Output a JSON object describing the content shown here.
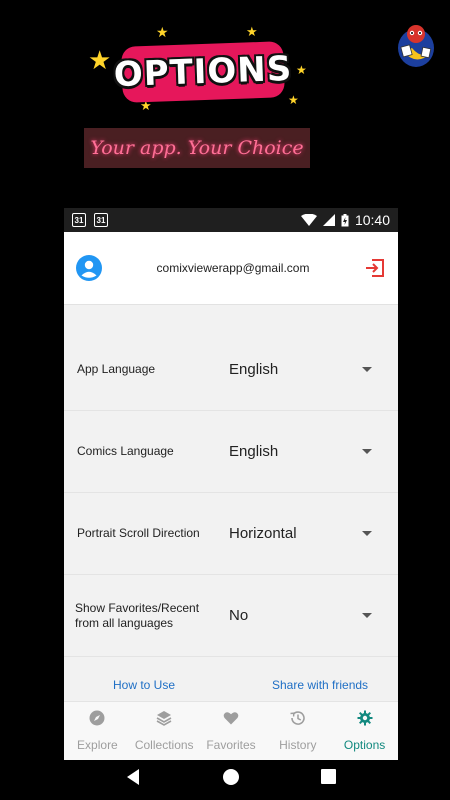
{
  "promo": {
    "title": "OPTIONS",
    "subtitle": "Your app. Your Choice"
  },
  "status_bar": {
    "calendar_day_1": "31",
    "calendar_day_2": "31",
    "time": "10:40"
  },
  "account": {
    "email": "comixviewerapp@gmail.com"
  },
  "settings": [
    {
      "label": "App Language",
      "value": "English"
    },
    {
      "label": "Comics Language",
      "value": "English"
    },
    {
      "label": "Portrait Scroll Direction",
      "value": "Horizontal"
    },
    {
      "label": "Show Favorites/Recent from all languages",
      "value": "No"
    }
  ],
  "links": {
    "how_to_use": "How to Use",
    "share": "Share with friends"
  },
  "bottom_nav": [
    {
      "label": "Explore",
      "icon": "compass-icon"
    },
    {
      "label": "Collections",
      "icon": "layers-icon"
    },
    {
      "label": "Favorites",
      "icon": "heart-icon"
    },
    {
      "label": "History",
      "icon": "history-icon"
    },
    {
      "label": "Options",
      "icon": "gear-icon",
      "active": true
    }
  ],
  "colors": {
    "accent": "#12897f",
    "link": "#1f6fc5",
    "logout": "#e53935",
    "avatar": "#2196f3",
    "title_badge": "#e6175b"
  }
}
